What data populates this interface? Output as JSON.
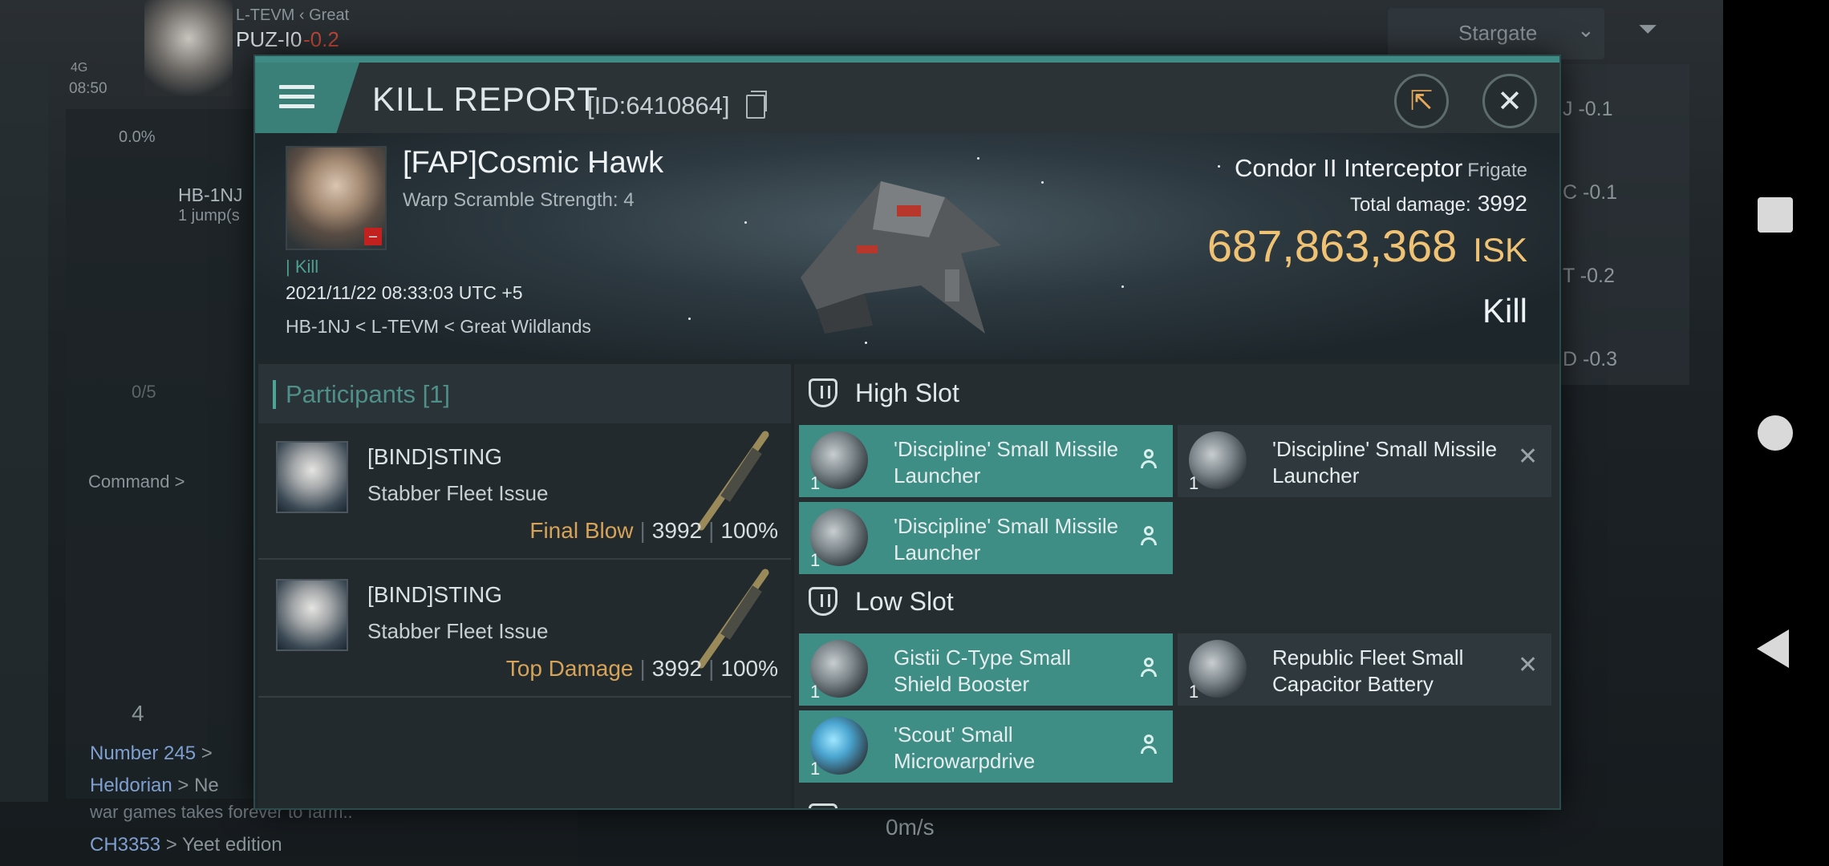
{
  "background": {
    "pilot_line_1": "L-TEVM ‹ Great",
    "pilot_system": "PUZ-I0",
    "pilot_security": "-0.2",
    "signal": "4G",
    "clock": "08:50",
    "cargo_percent": "0.0%",
    "nav_target": "HB-1NJ",
    "nav_jumps": "1 jump(s",
    "fleet_count": "0/5",
    "command_label": "Command >",
    "stargate_label": "Stargate",
    "right_list": [
      "J -0.1",
      "C -0.1",
      "T -0.2",
      "D -0.3"
    ],
    "people_count": "4",
    "chat": [
      {
        "name": "Number 245",
        "text": " > "
      },
      {
        "name": "Heldorian",
        "text": " > Ne"
      },
      {
        "name": "",
        "text": "war games takes forever to farm.."
      },
      {
        "name": "CH3353",
        "text": " > Yeet edition"
      }
    ],
    "speed": "0m/s"
  },
  "header": {
    "title": "KILL REPORT",
    "report_id": "[ID:6410864]"
  },
  "victim": {
    "name": "[FAP]Cosmic Hawk",
    "warp_scramble": "Warp Scramble Strength: 4",
    "kill_tag": "| Kill",
    "datetime": "2021/11/22 08:33:03 UTC +5",
    "location": "HB-1NJ < L-TEVM < Great Wildlands"
  },
  "ship": {
    "name": "Condor II Interceptor",
    "class": "Frigate",
    "total_damage_label": "Total damage:",
    "total_damage": "3992",
    "isk_value": "687,863,368",
    "isk_unit": "ISK",
    "report_type": "Kill"
  },
  "participants": {
    "header": "Participants [1]",
    "rows": [
      {
        "name": "[BIND]STING",
        "ship": "Stabber Fleet Issue",
        "role": "Final Blow",
        "damage": "3992",
        "percent": "100%"
      },
      {
        "name": "[BIND]STING",
        "ship": "Stabber Fleet Issue",
        "role": "Top Damage",
        "damage": "3992",
        "percent": "100%"
      }
    ]
  },
  "slots": {
    "high": {
      "label": "High Slot",
      "items": [
        {
          "name": "'Discipline' Small Missile Launcher",
          "qty": "1",
          "status": "pilot-icon"
        },
        {
          "name": "'Discipline' Small Missile Launcher",
          "qty": "1",
          "status": "close-icon"
        },
        {
          "name": "'Discipline' Small Missile Launcher",
          "qty": "1",
          "status": "pilot-icon"
        }
      ]
    },
    "low": {
      "label": "Low Slot",
      "items": [
        {
          "name": "Gistii C-Type Small Shield Booster",
          "qty": "1",
          "status": "pilot-icon"
        },
        {
          "name": "Republic Fleet Small Capacitor Battery",
          "qty": "1",
          "status": "close-icon"
        },
        {
          "name": "'Scout' Small Microwarpdrive",
          "qty": "1",
          "status": "pilot-icon"
        }
      ]
    }
  },
  "colors": {
    "accent_teal": "#3f8e86",
    "isk_gold": "#f0c374",
    "final_blow": "#d6a358"
  }
}
